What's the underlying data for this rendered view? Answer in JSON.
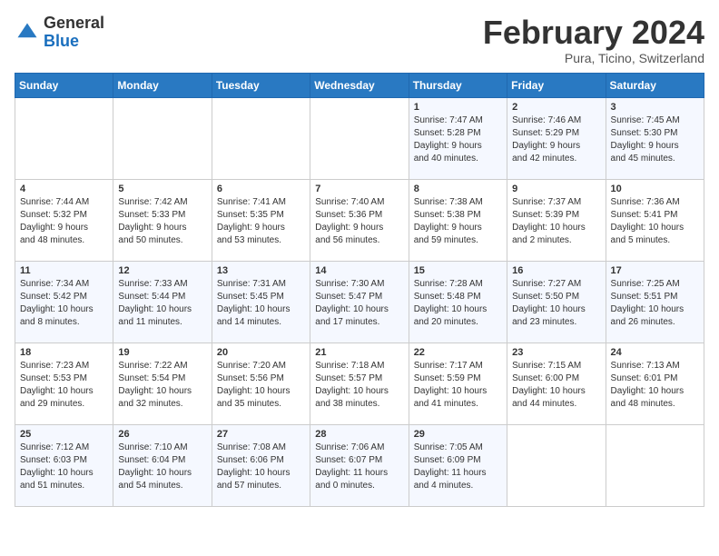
{
  "logo": {
    "general": "General",
    "blue": "Blue"
  },
  "title": {
    "month_year": "February 2024",
    "location": "Pura, Ticino, Switzerland"
  },
  "weekdays": [
    "Sunday",
    "Monday",
    "Tuesday",
    "Wednesday",
    "Thursday",
    "Friday",
    "Saturday"
  ],
  "weeks": [
    [
      {
        "day": "",
        "info": ""
      },
      {
        "day": "",
        "info": ""
      },
      {
        "day": "",
        "info": ""
      },
      {
        "day": "",
        "info": ""
      },
      {
        "day": "1",
        "info": "Sunrise: 7:47 AM\nSunset: 5:28 PM\nDaylight: 9 hours\nand 40 minutes."
      },
      {
        "day": "2",
        "info": "Sunrise: 7:46 AM\nSunset: 5:29 PM\nDaylight: 9 hours\nand 42 minutes."
      },
      {
        "day": "3",
        "info": "Sunrise: 7:45 AM\nSunset: 5:30 PM\nDaylight: 9 hours\nand 45 minutes."
      }
    ],
    [
      {
        "day": "4",
        "info": "Sunrise: 7:44 AM\nSunset: 5:32 PM\nDaylight: 9 hours\nand 48 minutes."
      },
      {
        "day": "5",
        "info": "Sunrise: 7:42 AM\nSunset: 5:33 PM\nDaylight: 9 hours\nand 50 minutes."
      },
      {
        "day": "6",
        "info": "Sunrise: 7:41 AM\nSunset: 5:35 PM\nDaylight: 9 hours\nand 53 minutes."
      },
      {
        "day": "7",
        "info": "Sunrise: 7:40 AM\nSunset: 5:36 PM\nDaylight: 9 hours\nand 56 minutes."
      },
      {
        "day": "8",
        "info": "Sunrise: 7:38 AM\nSunset: 5:38 PM\nDaylight: 9 hours\nand 59 minutes."
      },
      {
        "day": "9",
        "info": "Sunrise: 7:37 AM\nSunset: 5:39 PM\nDaylight: 10 hours\nand 2 minutes."
      },
      {
        "day": "10",
        "info": "Sunrise: 7:36 AM\nSunset: 5:41 PM\nDaylight: 10 hours\nand 5 minutes."
      }
    ],
    [
      {
        "day": "11",
        "info": "Sunrise: 7:34 AM\nSunset: 5:42 PM\nDaylight: 10 hours\nand 8 minutes."
      },
      {
        "day": "12",
        "info": "Sunrise: 7:33 AM\nSunset: 5:44 PM\nDaylight: 10 hours\nand 11 minutes."
      },
      {
        "day": "13",
        "info": "Sunrise: 7:31 AM\nSunset: 5:45 PM\nDaylight: 10 hours\nand 14 minutes."
      },
      {
        "day": "14",
        "info": "Sunrise: 7:30 AM\nSunset: 5:47 PM\nDaylight: 10 hours\nand 17 minutes."
      },
      {
        "day": "15",
        "info": "Sunrise: 7:28 AM\nSunset: 5:48 PM\nDaylight: 10 hours\nand 20 minutes."
      },
      {
        "day": "16",
        "info": "Sunrise: 7:27 AM\nSunset: 5:50 PM\nDaylight: 10 hours\nand 23 minutes."
      },
      {
        "day": "17",
        "info": "Sunrise: 7:25 AM\nSunset: 5:51 PM\nDaylight: 10 hours\nand 26 minutes."
      }
    ],
    [
      {
        "day": "18",
        "info": "Sunrise: 7:23 AM\nSunset: 5:53 PM\nDaylight: 10 hours\nand 29 minutes."
      },
      {
        "day": "19",
        "info": "Sunrise: 7:22 AM\nSunset: 5:54 PM\nDaylight: 10 hours\nand 32 minutes."
      },
      {
        "day": "20",
        "info": "Sunrise: 7:20 AM\nSunset: 5:56 PM\nDaylight: 10 hours\nand 35 minutes."
      },
      {
        "day": "21",
        "info": "Sunrise: 7:18 AM\nSunset: 5:57 PM\nDaylight: 10 hours\nand 38 minutes."
      },
      {
        "day": "22",
        "info": "Sunrise: 7:17 AM\nSunset: 5:59 PM\nDaylight: 10 hours\nand 41 minutes."
      },
      {
        "day": "23",
        "info": "Sunrise: 7:15 AM\nSunset: 6:00 PM\nDaylight: 10 hours\nand 44 minutes."
      },
      {
        "day": "24",
        "info": "Sunrise: 7:13 AM\nSunset: 6:01 PM\nDaylight: 10 hours\nand 48 minutes."
      }
    ],
    [
      {
        "day": "25",
        "info": "Sunrise: 7:12 AM\nSunset: 6:03 PM\nDaylight: 10 hours\nand 51 minutes."
      },
      {
        "day": "26",
        "info": "Sunrise: 7:10 AM\nSunset: 6:04 PM\nDaylight: 10 hours\nand 54 minutes."
      },
      {
        "day": "27",
        "info": "Sunrise: 7:08 AM\nSunset: 6:06 PM\nDaylight: 10 hours\nand 57 minutes."
      },
      {
        "day": "28",
        "info": "Sunrise: 7:06 AM\nSunset: 6:07 PM\nDaylight: 11 hours\nand 0 minutes."
      },
      {
        "day": "29",
        "info": "Sunrise: 7:05 AM\nSunset: 6:09 PM\nDaylight: 11 hours\nand 4 minutes."
      },
      {
        "day": "",
        "info": ""
      },
      {
        "day": "",
        "info": ""
      }
    ]
  ]
}
